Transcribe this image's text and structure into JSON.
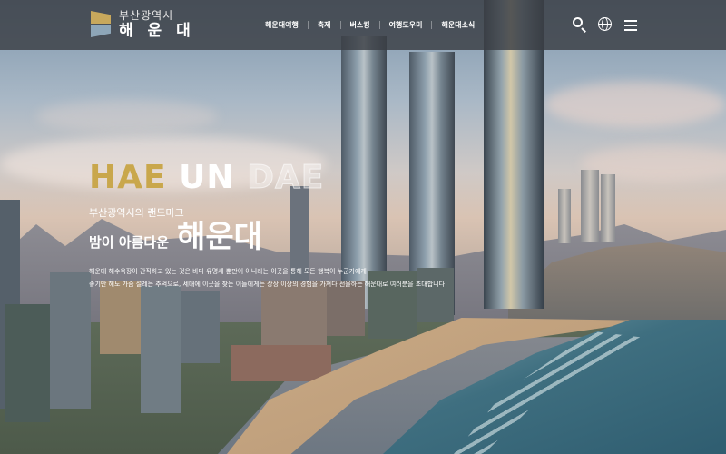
{
  "header": {
    "logo": {
      "sub": "부산광역시",
      "main": "해 운 대"
    },
    "nav": [
      "해운대여행",
      "축제",
      "버스킹",
      "여행도우미",
      "해운대소식"
    ],
    "icons": [
      "search-icon",
      "globe-icon",
      "menu-icon"
    ]
  },
  "hero": {
    "title_words": [
      "HAE",
      "UN",
      "DAE"
    ],
    "subline": "부산광역시의 랜드마크",
    "headline_pre": "밤이 아름다운",
    "headline_name": "해운대",
    "desc_lines": [
      "해운대 해수욕장이 간직하고 있는 것은 바다 유명세 뿐만이 아니라는 이곳을 통해 모든 행복이 누군가에게",
      "좋기만 해도 가슴 설레는 추억으로, 세대에 이곳을 찾는 이들에게는 상상 이상의 경험을 가져다 선물하는 해운대로 여러분을 초대합니다"
    ]
  },
  "colors": {
    "accent_gold": "#c9a74c",
    "topbar": "#3a3e44"
  }
}
